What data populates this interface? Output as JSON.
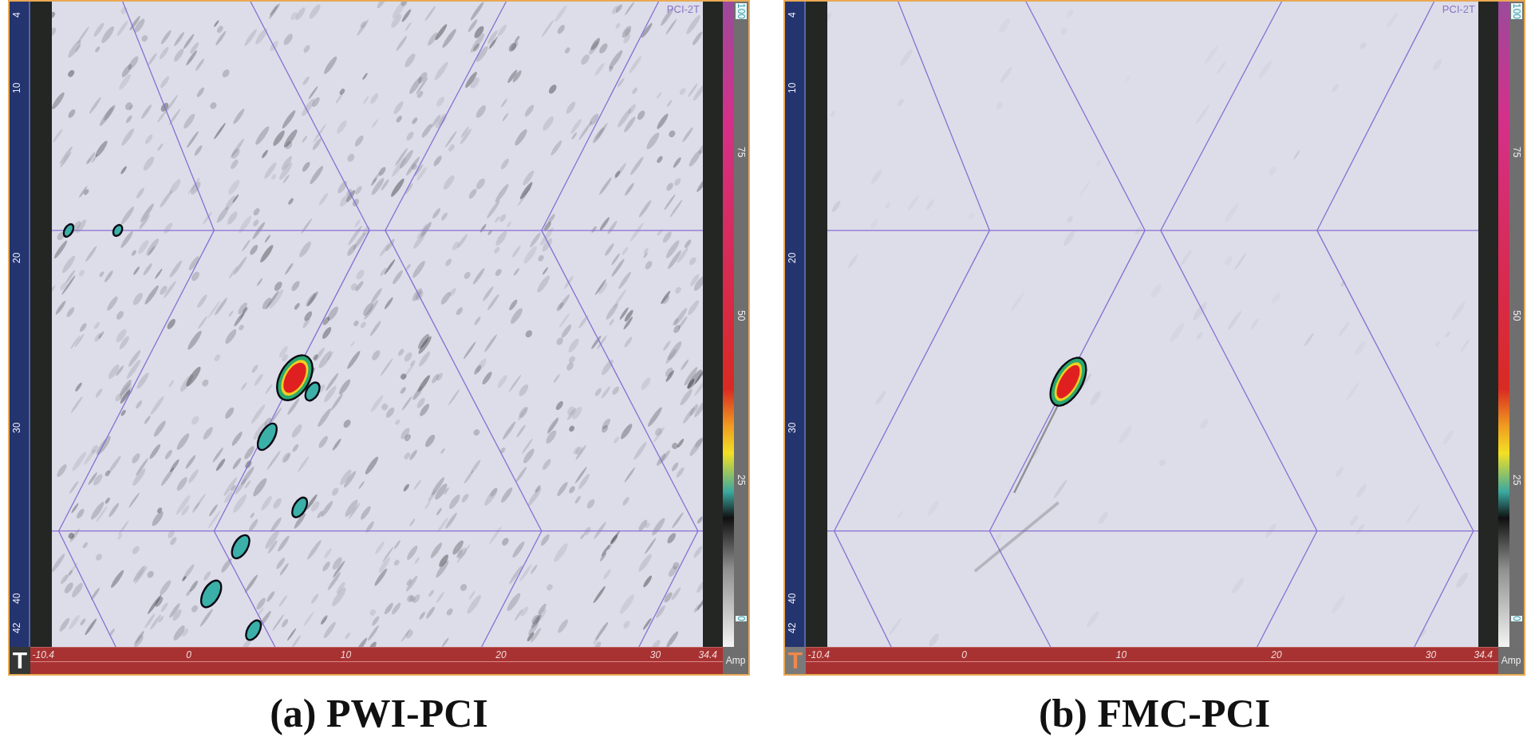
{
  "panels": [
    {
      "caption": "(a) PWI-PCI",
      "view_label": "PCI-2T",
      "mode_button": {
        "label": "T",
        "selected": false
      },
      "amp_button": "Amp",
      "scan": {
        "kind": "noisy"
      },
      "vertical_ruler": [
        "4",
        "10",
        "20",
        "30",
        "40",
        "42"
      ],
      "horizontal_ruler": [
        "-10.4",
        "0",
        "10",
        "20",
        "30",
        "34.4"
      ],
      "color_scale": [
        "100",
        "75",
        "50",
        "25",
        "0"
      ]
    },
    {
      "caption": "(b) FMC-PCI",
      "view_label": "PCI-2T",
      "mode_button": {
        "label": "T",
        "selected": true
      },
      "amp_button": "Amp",
      "scan": {
        "kind": "clean"
      },
      "vertical_ruler": [
        "4",
        "10",
        "20",
        "30",
        "40",
        "42"
      ],
      "horizontal_ruler": [
        "-10.4",
        "0",
        "10",
        "20",
        "30",
        "34.4"
      ],
      "color_scale": [
        "100",
        "75",
        "50",
        "25",
        "0"
      ]
    }
  ]
}
